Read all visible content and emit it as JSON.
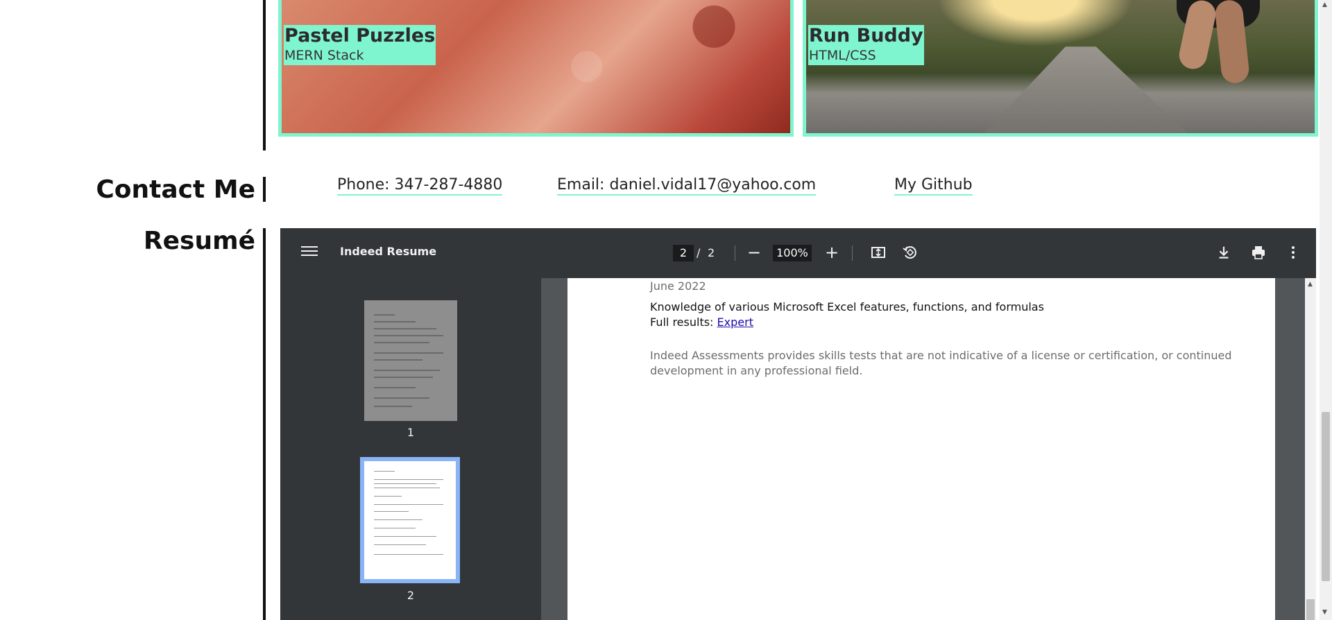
{
  "projects": [
    {
      "title": "Pastel Puzzles",
      "stack": "MERN Stack"
    },
    {
      "title": "Run Buddy",
      "stack": "HTML/CSS"
    }
  ],
  "contact": {
    "heading": "Contact Me",
    "phone": "Phone: 347-287-4880",
    "email": "Email: daniel.vidal17@yahoo.com",
    "github": "My Github"
  },
  "resume": {
    "heading": "Resumé",
    "viewer": {
      "doc_title": "Indeed Resume",
      "current_page": "2",
      "separator": "/",
      "total_pages": "2",
      "zoom": "100%",
      "icons": [
        "menu-icon",
        "zoom-out-icon",
        "zoom-in-icon",
        "fit-page-icon",
        "rotate-icon",
        "download-icon",
        "print-icon",
        "more-icon"
      ],
      "thumbnails": [
        "1",
        "2"
      ],
      "page_content": {
        "date": "June 2022",
        "line1": "Knowledge of various Microsoft Excel features, functions, and formulas",
        "results_label": "Full results:",
        "results_link": "Expert",
        "disclaimer_line1": "Indeed Assessments provides skills tests that are not indicative of a license or certification, or continued",
        "disclaimer_line2": "development in any professional field."
      }
    }
  },
  "colors": {
    "accent": "#7ff5cf",
    "toolbar": "#323639",
    "viewer_bg": "#525659"
  }
}
